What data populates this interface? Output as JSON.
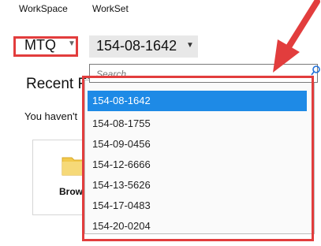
{
  "workspace": {
    "label": "WorkSpace",
    "value": "MTQ"
  },
  "workset": {
    "label": "WorkSet",
    "value": "154-08-1642",
    "search_placeholder": "Search",
    "options": [
      {
        "label": "154-08-1642",
        "selected": true
      },
      {
        "label": "154-08-1755",
        "selected": false
      },
      {
        "label": "154-09-0456",
        "selected": false
      },
      {
        "label": "154-12-6666",
        "selected": false
      },
      {
        "label": "154-13-5626",
        "selected": false
      },
      {
        "label": "154-17-0483",
        "selected": false
      },
      {
        "label": "154-20-0204",
        "selected": false
      }
    ]
  },
  "recent": {
    "title": "Recent Fi",
    "subtitle": "You haven't",
    "browse_label": "Brows"
  },
  "colors": {
    "annotation_red": "#e23d3d",
    "selection_blue": "#1e8ae6"
  },
  "icons": [
    "chevron-down-icon",
    "search-icon",
    "folder-icon",
    "arrow-annotation"
  ]
}
